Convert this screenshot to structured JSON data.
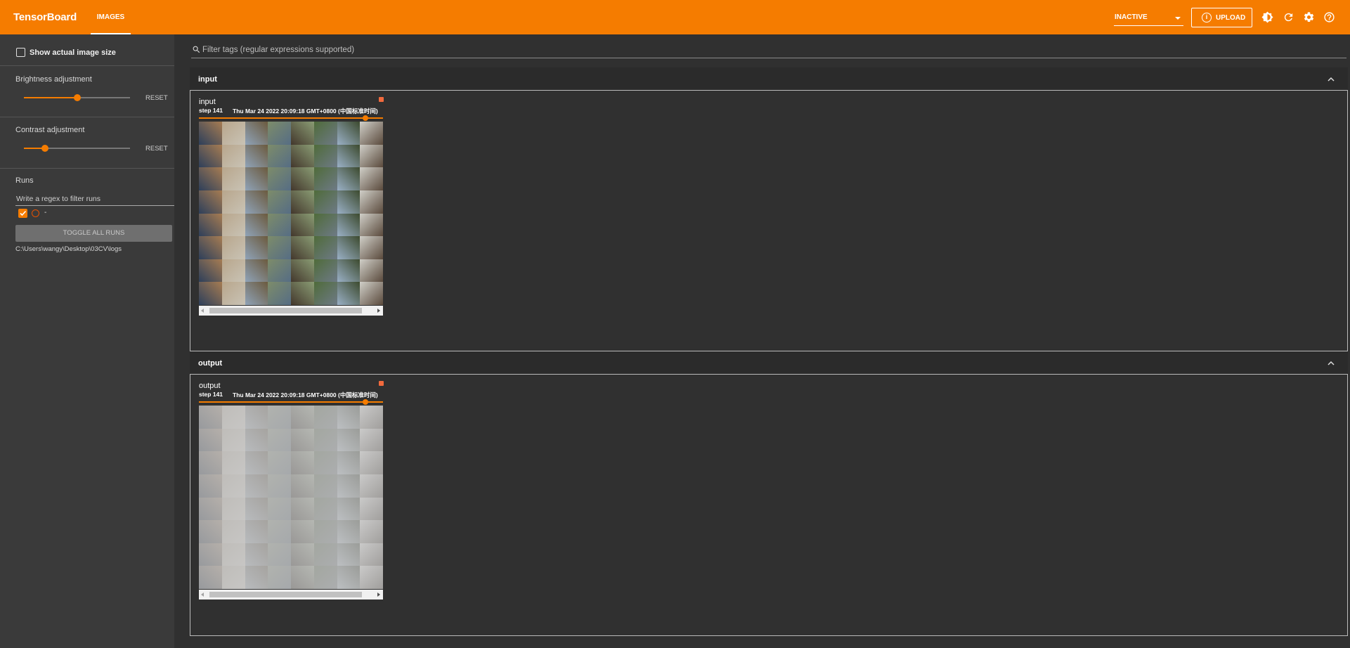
{
  "app": {
    "brand": "TensorBoard",
    "active_tab": "IMAGES",
    "status_select": "INACTIVE",
    "upload_label": "UPLOAD",
    "accent_color": "#f57c00"
  },
  "toolbar_icons": [
    "theme-toggle-icon",
    "refresh-icon",
    "settings-icon",
    "help-icon"
  ],
  "sidebar": {
    "show_actual_size_label": "Show actual image size",
    "show_actual_size_checked": false,
    "brightness": {
      "title": "Brightness adjustment",
      "reset_label": "RESET",
      "value_fraction": 0.5
    },
    "contrast": {
      "title": "Contrast adjustment",
      "reset_label": "RESET",
      "value_fraction": 0.2
    },
    "runs": {
      "title": "Runs",
      "filter_placeholder": "Write a regex to filter runs",
      "items": [
        {
          "name": "-",
          "checked": true,
          "color": "#e65100"
        }
      ],
      "toggle_all_label": "TOGGLE ALL RUNS",
      "log_dir": "C:\\Users\\wangy\\Desktop\\03CV\\logs"
    }
  },
  "main": {
    "filter_placeholder": "Filter tags (regular expressions supported)",
    "groups": [
      {
        "title": "input",
        "expanded": true,
        "card": {
          "tag": "input",
          "step_label": "step 141",
          "timestamp": "Thu Mar 24 2022 20:09:18 GMT+0800 (中国标准时间)",
          "step_fraction": 0.93,
          "faded": false
        }
      },
      {
        "title": "output",
        "expanded": true,
        "card": {
          "tag": "output",
          "step_label": "step 141",
          "timestamp": "Thu Mar 24 2022 20:09:18 GMT+0800 (中国标准时间)",
          "step_fraction": 0.93,
          "faded": true
        }
      }
    ]
  }
}
